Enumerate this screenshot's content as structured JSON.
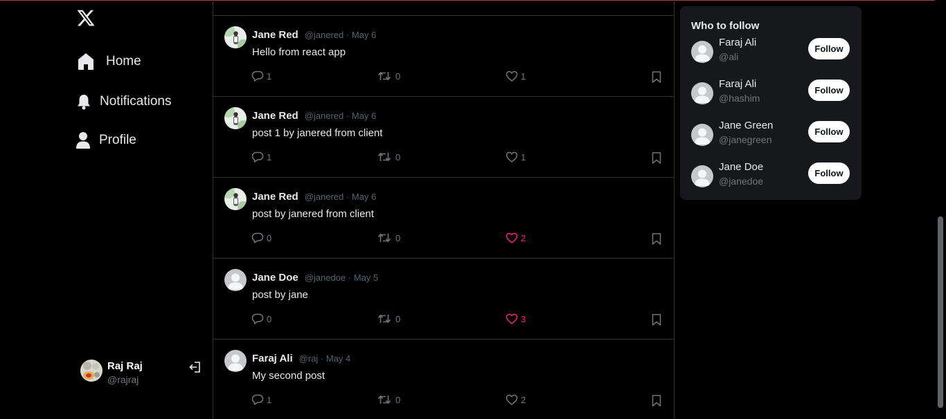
{
  "sidebar": {
    "nav": [
      {
        "label": "Home"
      },
      {
        "label": "Notifications"
      },
      {
        "label": "Profile"
      }
    ],
    "current_user": {
      "name": "Raj Raj",
      "handle": "@rajraj"
    }
  },
  "feed": {
    "posts": [
      {
        "author": "Jane Red",
        "handle": "@janered",
        "date": "May 6",
        "text": "Hello from react app",
        "replies": "1",
        "retweets": "0",
        "likes": "1",
        "liked": false,
        "avatar": "photo"
      },
      {
        "author": "Jane Red",
        "handle": "@janered",
        "date": "May 6",
        "text": "post 1 by janered from client",
        "replies": "1",
        "retweets": "0",
        "likes": "1",
        "liked": false,
        "avatar": "photo"
      },
      {
        "author": "Jane Red",
        "handle": "@janered",
        "date": "May 6",
        "text": "post by janered from client",
        "replies": "0",
        "retweets": "0",
        "likes": "2",
        "liked": true,
        "avatar": "photo"
      },
      {
        "author": "Jane Doe",
        "handle": "@janedoe",
        "date": "May 5",
        "text": "post by jane",
        "replies": "0",
        "retweets": "0",
        "likes": "3",
        "liked": true,
        "avatar": "default"
      },
      {
        "author": "Faraj Ali",
        "handle": "@raj",
        "date": "May 4",
        "text": "My second post",
        "replies": "1",
        "retweets": "0",
        "likes": "2",
        "liked": false,
        "avatar": "default"
      }
    ]
  },
  "who_to_follow": {
    "title": "Who to follow",
    "users": [
      {
        "name": "Faraj Ali",
        "handle": "@ali",
        "button": "Follow"
      },
      {
        "name": "Faraj Ali",
        "handle": "@hashim",
        "button": "Follow"
      },
      {
        "name": "Jane Green",
        "handle": "@janegreen",
        "button": "Follow"
      },
      {
        "name": "Jane Doe",
        "handle": "@janedoe",
        "button": "Follow"
      }
    ]
  },
  "colors": {
    "accent_like": "#f91880",
    "muted": "#71767b",
    "border": "#2f3336",
    "panel": "#16181c"
  }
}
